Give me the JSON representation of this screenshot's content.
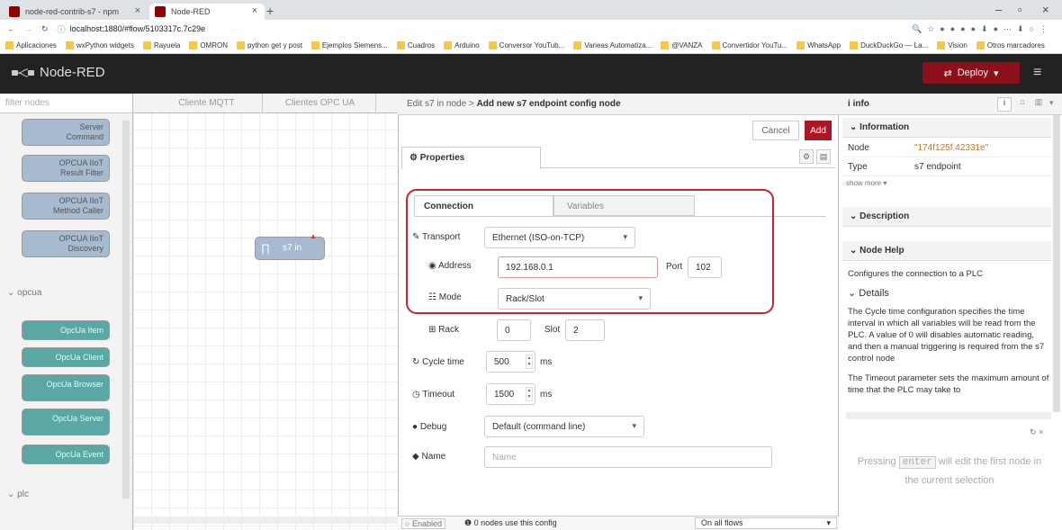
{
  "browser": {
    "tabs": [
      {
        "label": "node-red-contrib-s7 - npm"
      },
      {
        "label": "Node-RED"
      }
    ],
    "url": "localhost:1880/#flow/5103317c.7c29e",
    "bookmarks": [
      "Aplicaciones",
      "wxPython widgets",
      "Rayuela",
      "OMRON",
      "python get y post",
      "Ejemplos Siemens...",
      "Cuadros",
      "Arduino",
      "Conversor YouTub...",
      "Varieas Automatiza...",
      "@VANZA",
      "Convertidor YouTu...",
      "WhatsApp",
      "DuckDuckGo — La...",
      "Vision",
      "Otros marcadores"
    ]
  },
  "header": {
    "app_title": "Node-RED",
    "deploy_label": "Deploy"
  },
  "palette": {
    "filter_placeholder": "filter nodes",
    "nodes_top": [
      "Server Command",
      "OPCUA IIoT Result Filter",
      "OPCUA IIoT Method Caller",
      "OPCUA IIoT Discovery"
    ],
    "category_opcua": "opcua",
    "opcua_nodes": [
      "OpcUa Item",
      "OpcUa Client",
      "OpcUa Browser",
      "OpcUa Server",
      "OpcUa Event"
    ],
    "category_plc": "plc"
  },
  "workspace": {
    "tabs": [
      "Cliente MQTT",
      "Clientes OPC UA"
    ],
    "node_label": "s7 in"
  },
  "editor": {
    "breadcrumb_prefix": "Edit s7 in node > ",
    "breadcrumb_title": "Add new s7 endpoint config node",
    "cancel_label": "Cancel",
    "add_label": "Add",
    "properties_tab": "Properties",
    "connection_tab": "Connection",
    "variables_tab": "Variables",
    "transport_label": "Transport",
    "transport_value": "Ethernet (ISO-on-TCP)",
    "address_label": "Address",
    "address_value": "192.168.0.1",
    "port_label": "Port",
    "port_value": "102",
    "mode_label": "Mode",
    "mode_value": "Rack/Slot",
    "rack_label": "Rack",
    "rack_value": "0",
    "slot_label": "Slot",
    "slot_value": "2",
    "cycle_label": "Cycle time",
    "cycle_value": "500",
    "cycle_unit": "ms",
    "timeout_label": "Timeout",
    "timeout_value": "1500",
    "timeout_unit": "ms",
    "debug_label": "Debug",
    "debug_value": "Default (command line)",
    "name_label": "Name",
    "name_placeholder": "Name",
    "enabled_label": "Enabled",
    "usage_text": "0 nodes use this config",
    "scope_value": "On all flows"
  },
  "sidebar": {
    "tab_label": "info",
    "information_header": "Information",
    "node_key": "Node",
    "node_value": "\"174f125f.42331e\"",
    "type_key": "Type",
    "type_value": "s7 endpoint",
    "show_more": "show more",
    "description_header": "Description",
    "help_header": "Node Help",
    "help_intro": "Configures the connection to a PLC",
    "details_header": "Details",
    "help_p1": "The Cycle time configuration specifies the time interval in which all variables will be read from the PLC. A value of 0 will disables automatic reading, and then a manual triggering is required from the s7 control node",
    "help_p2": "The Timeout parameter sets the maximum amount of time that the PLC may take to",
    "hint_pre": "Pressing",
    "hint_key": "enter",
    "hint_post": "will edit the first node in the current selection"
  }
}
